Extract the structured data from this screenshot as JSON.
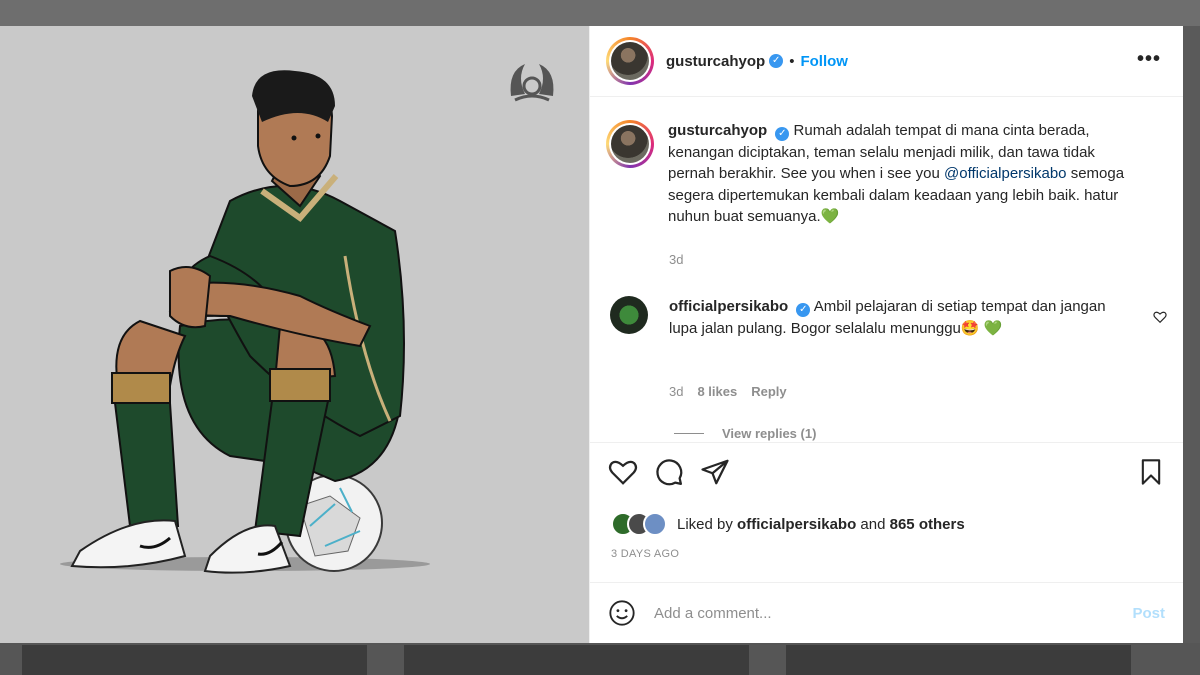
{
  "post": {
    "username": "gusturcahyop",
    "follow_label": "Follow",
    "more_label": "•••",
    "caption_text": "Rumah adalah tempat di mana cinta berada, kenangan diciptakan, teman selalu menjadi milik, dan tawa tidak pernah berakhir. See you when i see you ",
    "caption_mention": "@officialpersikabo",
    "caption_text_2": " semoga segera dipertemukan kembali dalam keadaan yang lebih baik. hatur nuhun buat semuanya.",
    "caption_emoji": "💚",
    "caption_time": "3d"
  },
  "reply": {
    "username": "officialpersikabo",
    "text": "Ambil pelajaran di setiap tempat dan jangan lupa jalan pulang. Bogor selalalu menunggu",
    "emoji": "🤩 💚",
    "time": "3d",
    "likes": "8 likes",
    "reply_label": "Reply",
    "view_replies": "View replies (1)"
  },
  "likes": {
    "prefix": "Liked by ",
    "user": "officialpersikabo",
    "middle": " and ",
    "others": "865 others"
  },
  "post_age": "3 DAYS AGO",
  "comment_box": {
    "placeholder": "Add a comment...",
    "post_label": "Post"
  },
  "colors": {
    "accent": "#0095f6",
    "verified": "#3897f0",
    "jersey": "#1e4a2c",
    "muted": "#8e8e8e"
  },
  "icons": [
    "like-icon",
    "comment-icon",
    "share-icon",
    "save-icon",
    "emoji-icon",
    "verified-icon",
    "more-icon"
  ]
}
